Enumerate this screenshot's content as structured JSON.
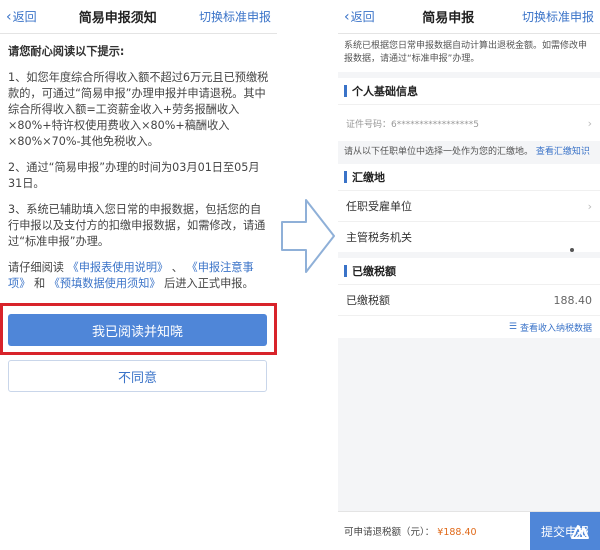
{
  "left": {
    "nav": {
      "back": "返回",
      "title": "简易申报须知",
      "switch": "切换标准申报"
    },
    "notice": {
      "head": "请您耐心阅读以下提示:",
      "p1": "1、如您年度综合所得收入额不超过6万元且已预缴税款的，可通过“简易申报”办理申报并申请退税。其中综合所得收入额=工资薪金收入+劳务报酬收入×80%+特许权使用费收入×80%+稿酬收入×80%×70%-其他免税收入。",
      "p2": "2、通过“简易申报”办理的时间为03月01日至05月31日。",
      "p3": "3、系统已辅助填入您日常的申报数据，包括您的自行申报以及支付方的扣缴申报数据，如需修改，请通过“标准申报”办理。",
      "p4_pre": "请仔细阅读",
      "p4_link1": "《申报表使用说明》",
      "p4_sep1": "、",
      "p4_link2": "《申报注意事项》",
      "p4_sep2": "和",
      "p4_link3": "《预填数据使用须知》",
      "p4_post": "后进入正式申报。"
    },
    "buttons": {
      "agree": "我已阅读并知晓",
      "disagree": "不同意"
    }
  },
  "right": {
    "nav": {
      "back": "返回",
      "title": "简易申报",
      "switch": "切换标准申报"
    },
    "banner": "系统已根据您日常申报数据自动计算出退税金额。如需修改申报数据，请通过“标准申报”办理。",
    "basic": {
      "title": "个人基础信息",
      "id_label": "证件号码：",
      "id_value": "6*****************5"
    },
    "tip": {
      "text": "请从以下任职单位中选择一处作为您的汇缴地。",
      "link": "查看汇缴知识"
    },
    "location": {
      "title": "汇缴地",
      "employer": "任职受雇单位",
      "tax_office": "主管税务机关"
    },
    "paid": {
      "title": "已缴税额",
      "label": "已缴税额",
      "value": "188.40",
      "link": "查看收入纳税数据"
    },
    "bottom": {
      "label": "可申请退税额（元）：",
      "amount": "¥188.40",
      "submit": "提交申报"
    }
  }
}
